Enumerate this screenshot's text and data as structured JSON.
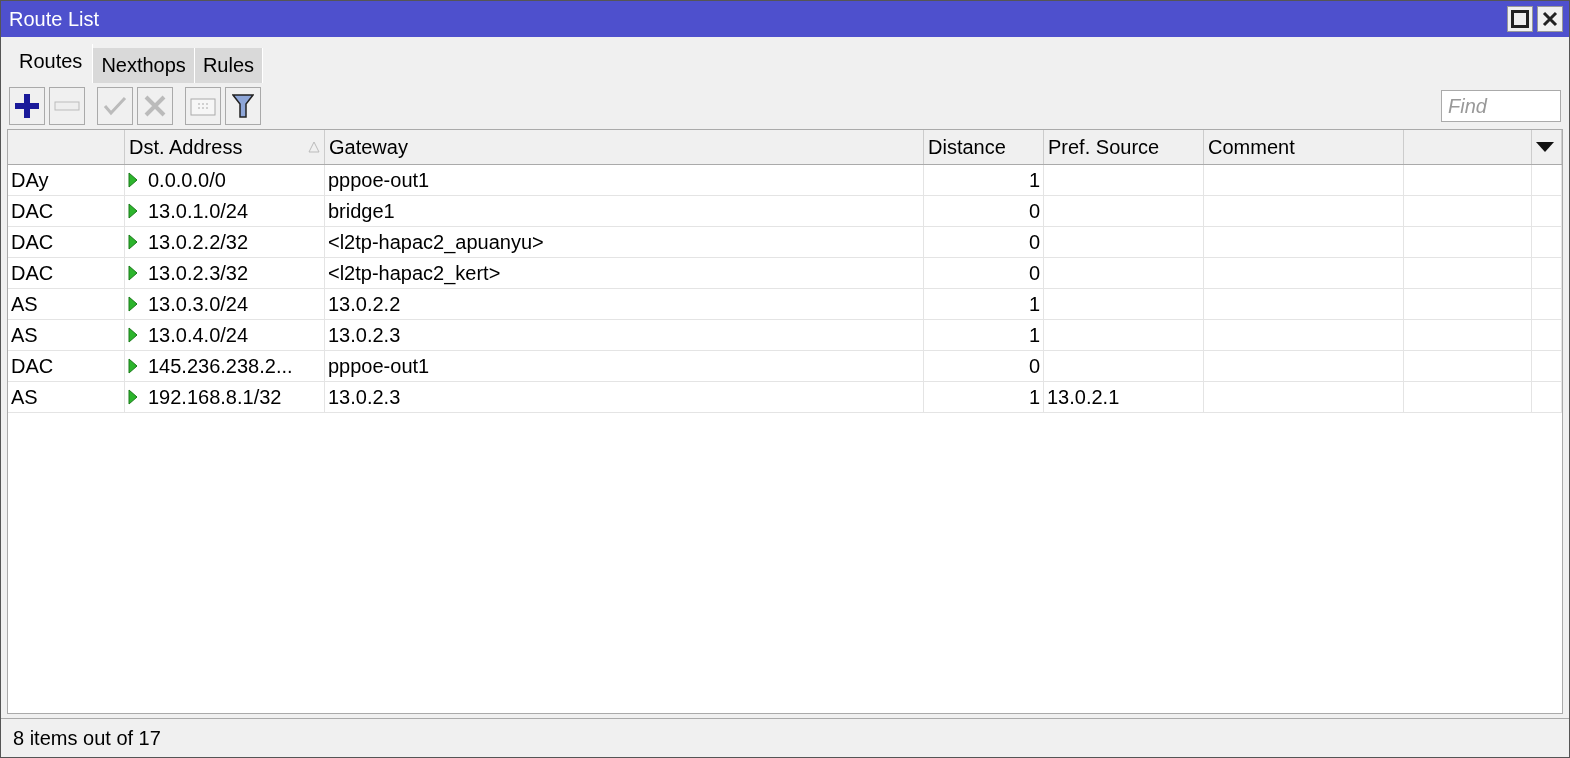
{
  "window": {
    "title": "Route List"
  },
  "tabs": [
    {
      "label": "Routes",
      "selected": true
    },
    {
      "label": "Nexthops",
      "selected": false
    },
    {
      "label": "Rules",
      "selected": false
    }
  ],
  "toolbar": [
    {
      "kind": "add",
      "disabled": false
    },
    {
      "kind": "remove",
      "disabled": true
    },
    {
      "kind": "enable",
      "disabled": true
    },
    {
      "kind": "disable",
      "disabled": true
    },
    {
      "kind": "comment",
      "disabled": true
    },
    {
      "kind": "filter",
      "disabled": false
    }
  ],
  "search": {
    "placeholder": "Find"
  },
  "table": {
    "columns": [
      {
        "sorted": false
      },
      {
        "label": "Dst. Address",
        "sorted": true
      },
      {
        "label": "Gateway",
        "sorted": false
      },
      {
        "label": "Distance",
        "sorted": false
      },
      {
        "label": "Pref. Source",
        "sorted": false
      },
      {
        "label": "Comment",
        "sorted": false
      },
      {
        "sorted": false
      }
    ],
    "rows": [
      {
        "flags": "DAy",
        "active": true,
        "dst": "0.0.0.0/0",
        "gateway": "pppoe-out1",
        "distance": "1"
      },
      {
        "flags": "DAC",
        "active": true,
        "dst": "13.0.1.0/24",
        "gateway": "bridge1",
        "distance": "0"
      },
      {
        "flags": "DAC",
        "active": true,
        "dst": "13.0.2.2/32",
        "gateway": "<l2tp-hapac2_apuanyu>",
        "distance": "0"
      },
      {
        "flags": "DAC",
        "active": true,
        "dst": "13.0.2.3/32",
        "gateway": "<l2tp-hapac2_kert>",
        "distance": "0"
      },
      {
        "flags": "AS",
        "active": true,
        "dst": "13.0.3.0/24",
        "gateway": "13.0.2.2",
        "distance": "1"
      },
      {
        "flags": "AS",
        "active": true,
        "dst": "13.0.4.0/24",
        "gateway": "13.0.2.3",
        "distance": "1"
      },
      {
        "flags": "DAC",
        "active": true,
        "dst": "145.236.238.2...",
        "gateway": "pppoe-out1",
        "distance": "0"
      },
      {
        "flags": "AS",
        "active": true,
        "dst": "192.168.8.1/32",
        "gateway": "13.0.2.3",
        "distance": "1",
        "pref_source": "13.0.2.1"
      }
    ]
  },
  "status_bar": "8 items out of 17"
}
